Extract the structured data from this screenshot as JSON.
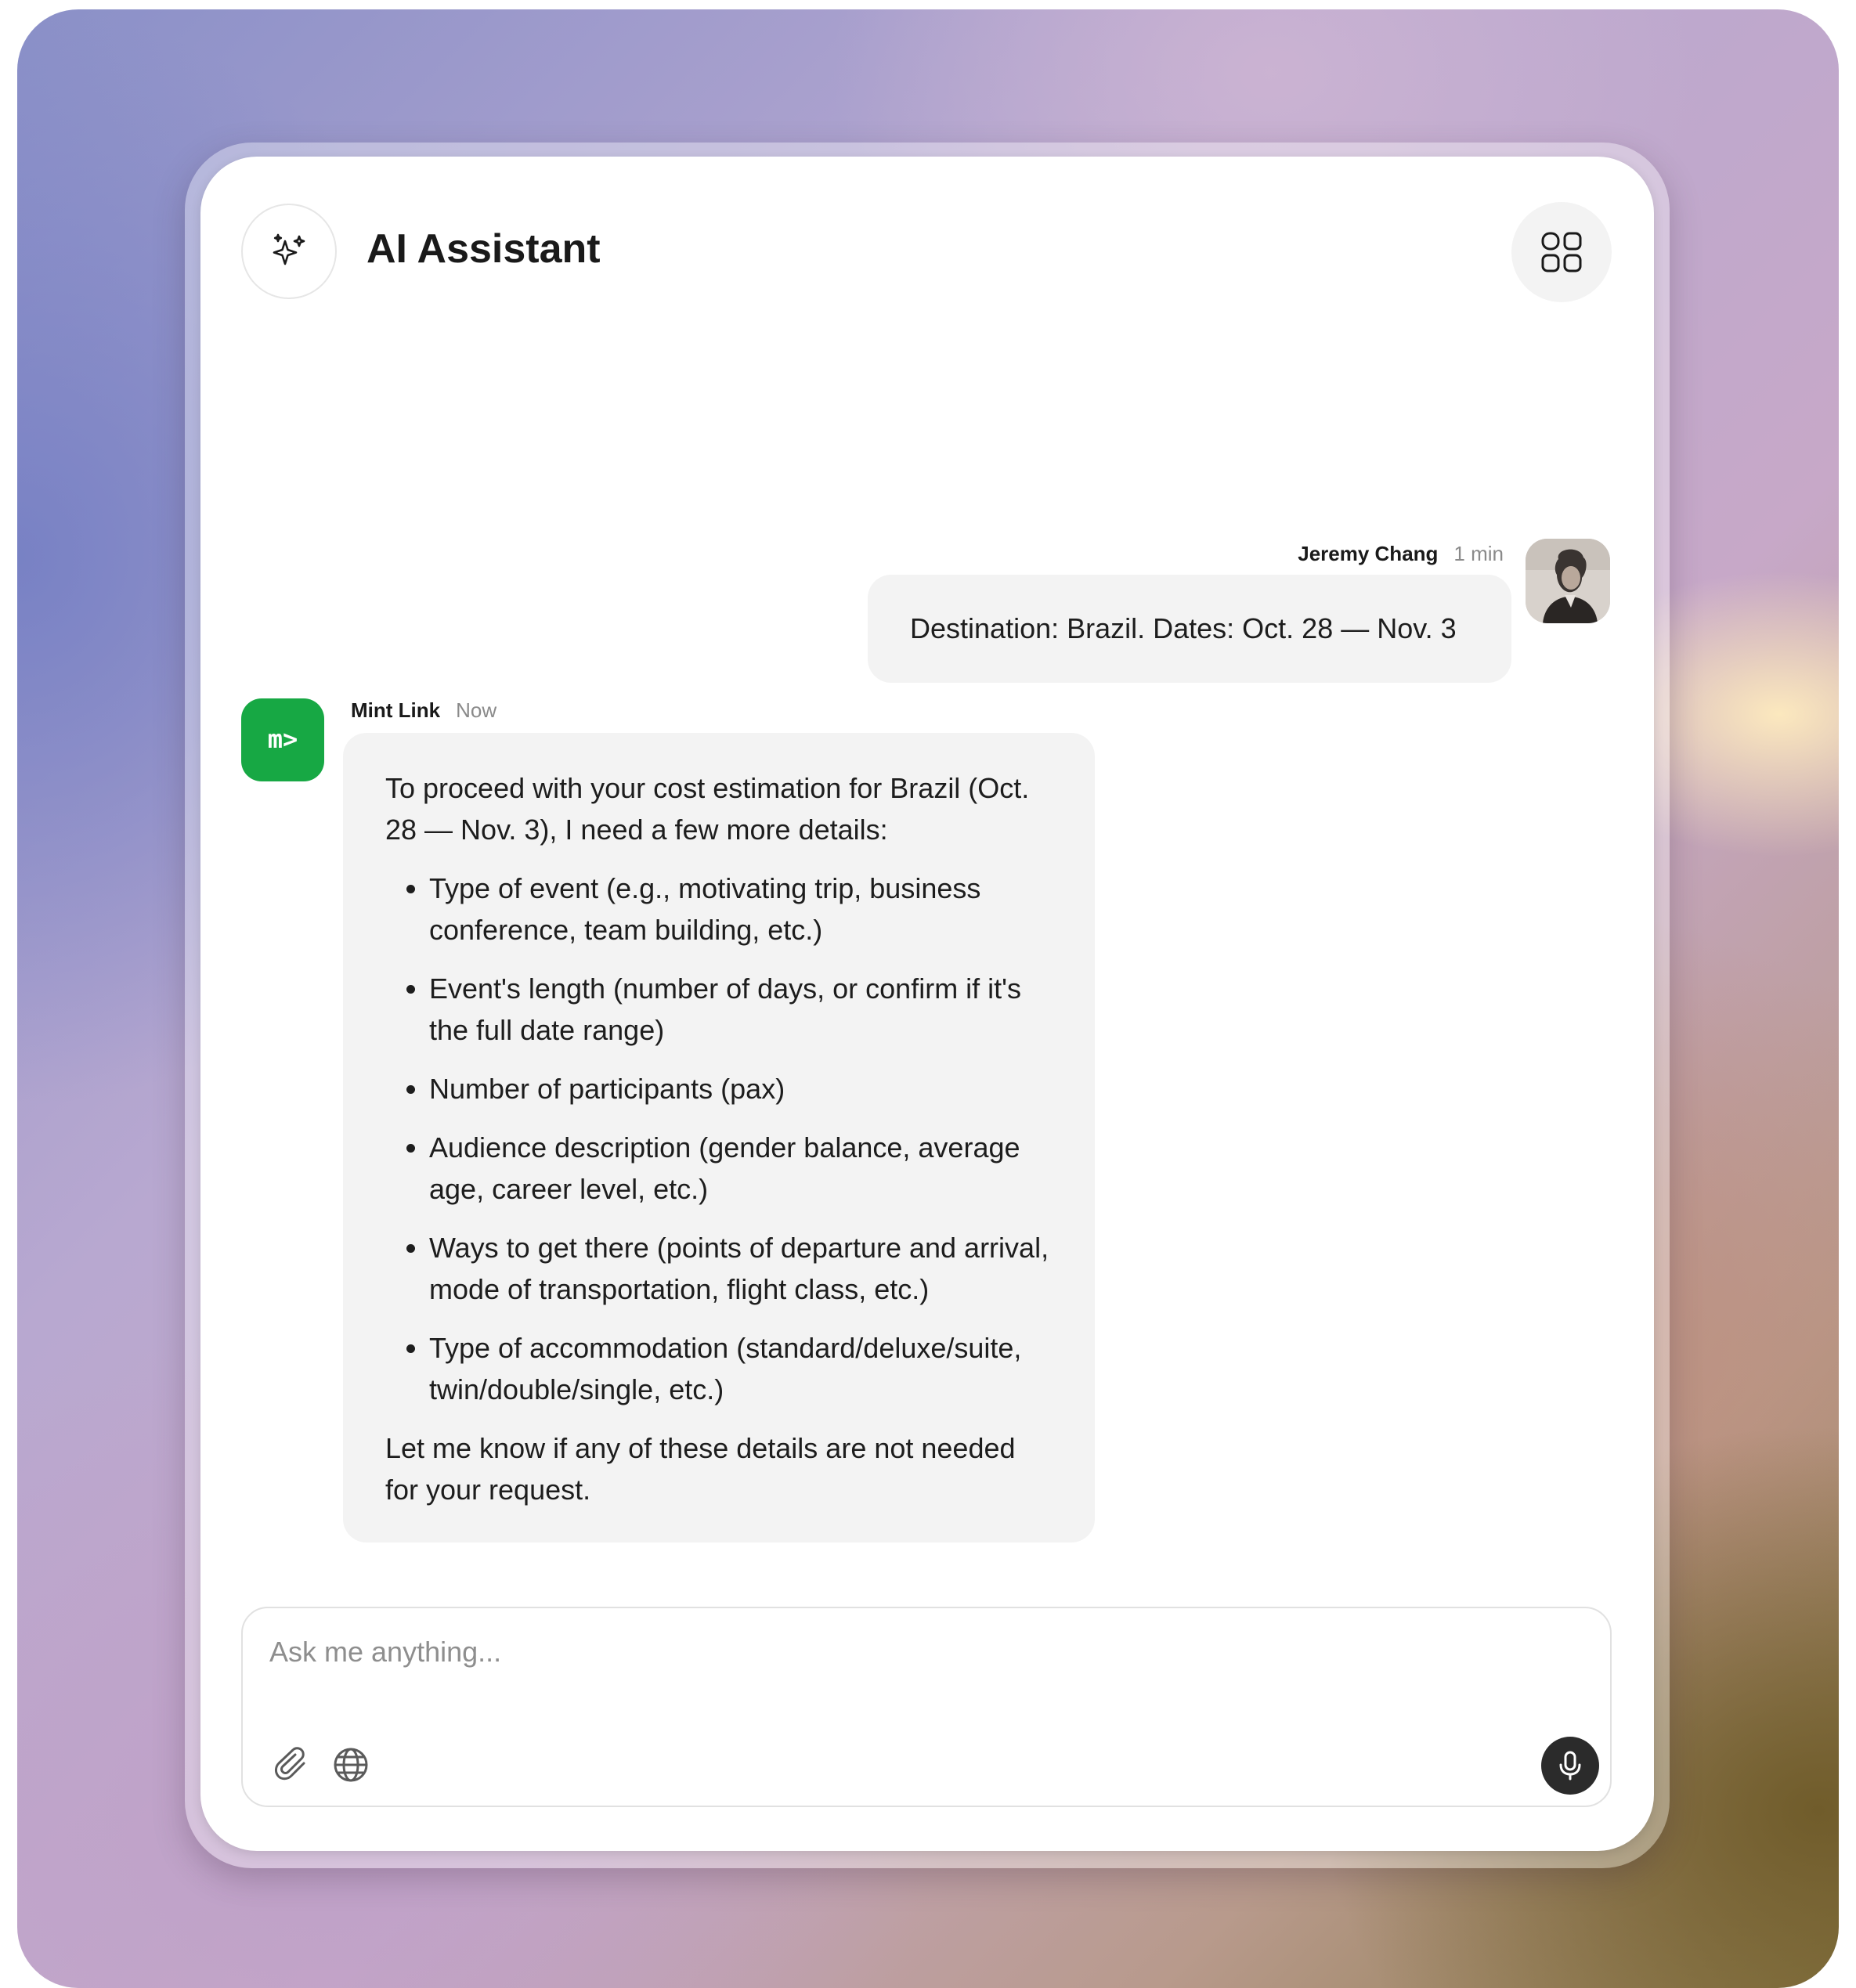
{
  "header": {
    "title": "AI Assistant",
    "leading_icon": "sparkles-icon",
    "apps_icon": "grid-apps-icon"
  },
  "messages": {
    "user": {
      "name": "Jeremy Chang",
      "time": "1 min",
      "text": "Destination: Brazil. Dates: Oct. 28 — Nov. 3"
    },
    "bot": {
      "name": "Mint Link",
      "time": "Now",
      "logo_text": "m>",
      "intro": "To proceed with your cost estimation for Brazil (Oct. 28 — Nov. 3), I need a few more details:",
      "items": [
        "Type of event (e.g., motivating trip, business conference, team building, etc.)",
        "Event's length (number of days, or confirm if it's the full date range)",
        "Number of participants (pax)",
        "Audience description (gender balance, average age, career level, etc.)",
        "Ways to get there (points of departure and arrival, mode of transportation, flight class, etc.)",
        "Type of accommodation (standard/deluxe/suite, twin/double/single, etc.)"
      ],
      "outro": "Let me know if any of these details are not needed for your request."
    }
  },
  "composer": {
    "placeholder": "Ask me anything...",
    "value": "",
    "attach_icon": "paperclip-icon",
    "web_icon": "globe-icon",
    "mic_icon": "microphone-icon"
  },
  "colors": {
    "bot_brand": "#17a844",
    "bubble_bg": "#f3f3f3",
    "mic_bg": "#2b2b2b"
  }
}
